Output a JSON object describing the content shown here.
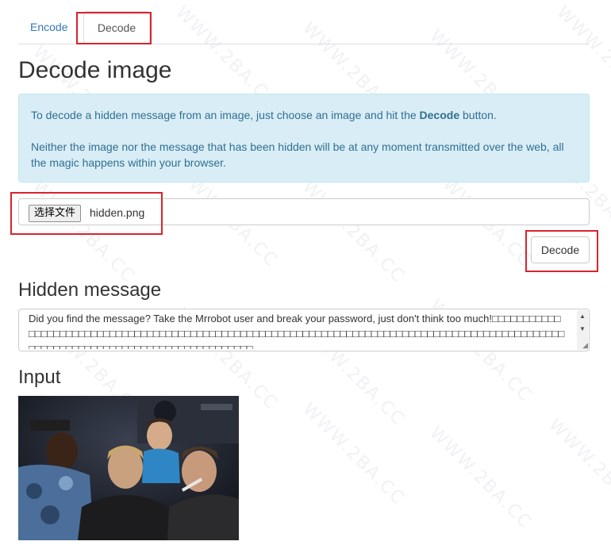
{
  "tabs": [
    {
      "label": "Encode",
      "active": false
    },
    {
      "label": "Decode",
      "active": true
    }
  ],
  "page_title": "Decode image",
  "info": {
    "line1_before": "To decode a hidden message from an image, just choose an image and hit the ",
    "line1_bold": "Decode",
    "line1_after": " button.",
    "line2": "Neither the image nor the message that has been hidden will be at any moment transmitted over the web, all the magic happens within your browser."
  },
  "file_input": {
    "button_label": "选择文件",
    "file_name": "hidden.png"
  },
  "decode_button_label": "Decode",
  "hidden_message": {
    "heading": "Hidden message",
    "text": "Did you find the message? Take the Mrrobot user and break your password, just don't think too much!□□□□□□□□□□□□□□□□□□□□□□□□□□□□□□□□□□□□□□□□□□□□□□□□□□□□□□□□□□□□□□□□□□□□□□□□□□□□□□□□□□□□□□□□□□□□□□□□□□□□□□□□□□□□□□□□□□□□□□□□□□□□□□□□□□□□□"
  },
  "input_heading": "Input",
  "colors": {
    "highlight": "#d9232d",
    "link": "#337ab7",
    "alert_bg": "#d9edf7",
    "alert_text": "#31708f"
  }
}
